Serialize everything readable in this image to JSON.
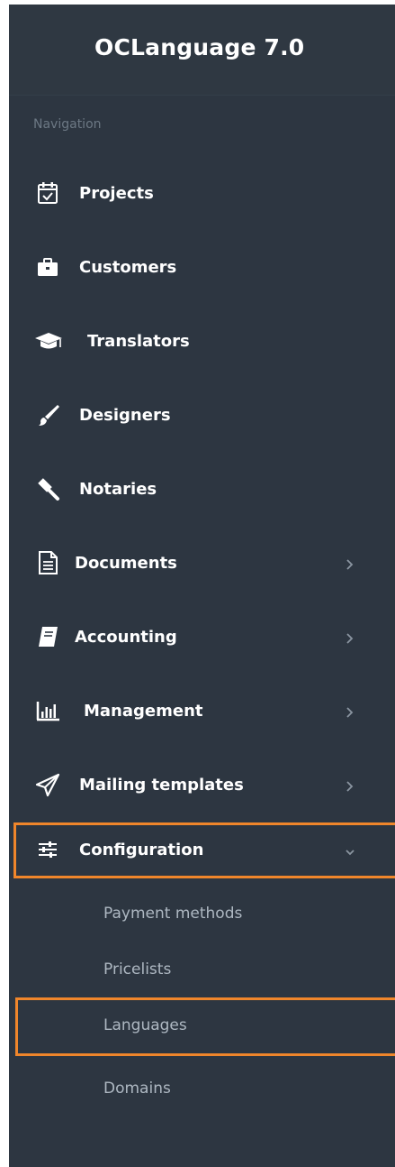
{
  "brand": {
    "title": "OCLanguage 7.0"
  },
  "navigation": {
    "heading": "Navigation",
    "items": [
      {
        "label": "Projects",
        "icon": "calendar-check-icon"
      },
      {
        "label": "Customers",
        "icon": "briefcase-icon"
      },
      {
        "label": "Translators",
        "icon": "graduation-cap-icon"
      },
      {
        "label": "Designers",
        "icon": "paint-brush-icon"
      },
      {
        "label": "Notaries",
        "icon": "gavel-icon"
      },
      {
        "label": "Documents",
        "icon": "document-icon",
        "has_submenu": true
      },
      {
        "label": "Accounting",
        "icon": "book-icon",
        "has_submenu": true
      },
      {
        "label": "Management",
        "icon": "bar-chart-icon",
        "has_submenu": true
      },
      {
        "label": "Mailing templates",
        "icon": "paper-plane-icon",
        "has_submenu": true
      },
      {
        "label": "Configuration",
        "icon": "sliders-icon",
        "has_submenu": true,
        "expanded": true
      }
    ],
    "configuration_submenu": [
      {
        "label": "Payment methods"
      },
      {
        "label": "Pricelists"
      },
      {
        "label": "Languages",
        "highlighted": true
      },
      {
        "label": "Domains"
      }
    ]
  },
  "colors": {
    "sidebar_bg": "#2d3641",
    "highlight": "#f0862b",
    "text": "#ffffff",
    "muted_text": "#6c7884",
    "sub_text": "#aeb8c2"
  }
}
